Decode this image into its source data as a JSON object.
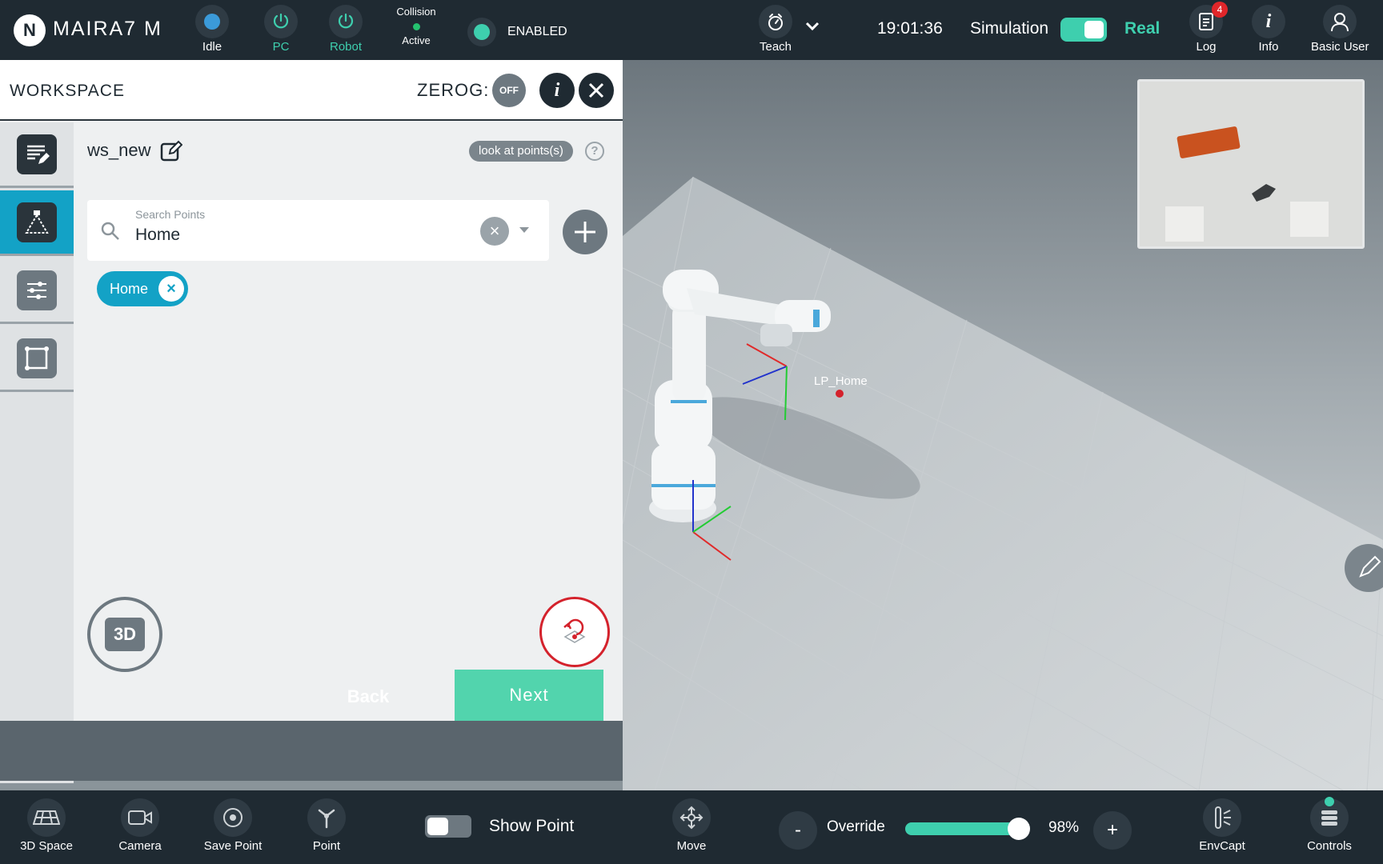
{
  "header": {
    "logo_text": "MAIRA7 M",
    "status_idle": "Idle",
    "pc": "PC",
    "robot": "Robot",
    "collision_title": "Collision",
    "collision_state": "Active",
    "enabled": "ENABLED",
    "teach": "Teach",
    "time": "19:01:36",
    "simulation": "Simulation",
    "real": "Real",
    "log": "Log",
    "log_badge": "4",
    "info": "Info",
    "user": "Basic User"
  },
  "panel": {
    "title": "WORKSPACE",
    "zerog_label": "ZEROG:",
    "zerog_state": "OFF",
    "workspace_name": "ws_new",
    "look_at_points": "look at points(s)",
    "help": "?",
    "search_label": "Search Points",
    "search_value": "Home",
    "chip": "Home",
    "cam3d_label": "3D",
    "back": "Back",
    "next": "Next"
  },
  "scene": {
    "point_label": "LP_Home"
  },
  "footer": {
    "space3d": "3D Space",
    "camera": "Camera",
    "save_point": "Save Point",
    "point": "Point",
    "show_point": "Show Point",
    "move": "Move",
    "minus": "-",
    "override": "Override",
    "override_value": "98%",
    "override_fraction": 0.98,
    "plus": "+",
    "envcapt": "EnvCapt",
    "controls": "Controls"
  },
  "colors": {
    "accent_teal": "#3ecfae",
    "accent_blue": "#13a2c6",
    "dark_bar": "#1f2a32",
    "danger": "#d4222c"
  }
}
